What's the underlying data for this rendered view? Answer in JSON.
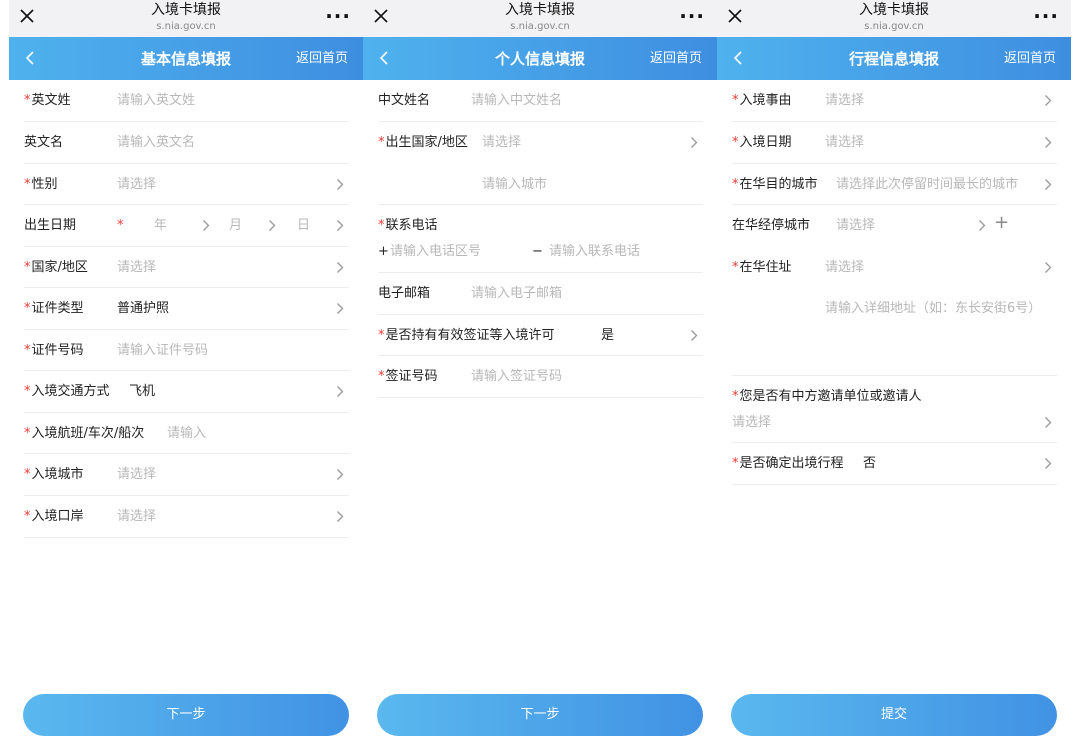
{
  "browser": {
    "title": "入境卡填报",
    "url": "s.nia.gov.cn",
    "more_icon": "···"
  },
  "required_mark": "*",
  "colors": {
    "header_start": "#4fb2ee",
    "header_end": "#3e8ee0",
    "required": "#e53935",
    "placeholder": "#b8b8b8"
  },
  "panels": [
    {
      "header": {
        "title": "基本信息填报",
        "home": "返回首页"
      },
      "fields": {
        "surname": {
          "label": "英文姓",
          "placeholder": "请输入英文姓"
        },
        "given_name": {
          "label": "英文名",
          "placeholder": "请输入英文名"
        },
        "gender": {
          "label": "性别",
          "placeholder": "请选择"
        },
        "birth_date": {
          "label": "出生日期",
          "year": "年",
          "month": "月",
          "day": "日"
        },
        "country": {
          "label": "国家/地区",
          "placeholder": "请选择"
        },
        "doc_type": {
          "label": "证件类型",
          "value": "普通护照"
        },
        "doc_number": {
          "label": "证件号码",
          "placeholder": "请输入证件号码"
        },
        "transport": {
          "label": "入境交通方式",
          "value": "飞机"
        },
        "flight": {
          "label": "入境航班/车次/船次",
          "placeholder": "请输入"
        },
        "city": {
          "label": "入境城市",
          "placeholder": "请选择"
        },
        "port": {
          "label": "入境口岸",
          "placeholder": "请选择"
        }
      },
      "button": "下一步"
    },
    {
      "header": {
        "title": "个人信息填报",
        "home": "返回首页"
      },
      "fields": {
        "chinese_name": {
          "label": "中文姓名",
          "placeholder": "请输入中文姓名"
        },
        "birth_country": {
          "label": "出生国家/地区",
          "placeholder": "请选择"
        },
        "birth_city": {
          "placeholder": "请输入城市"
        },
        "phone": {
          "label": "联系电话",
          "plus": "+",
          "code_placeholder": "请输入电话区号",
          "dash": "−",
          "number_placeholder": "请输入联系电话"
        },
        "email": {
          "label": "电子邮箱",
          "placeholder": "请输入电子邮箱"
        },
        "visa_hold": {
          "label": "是否持有有效签证等入境许可",
          "value": "是"
        },
        "visa_number": {
          "label": "签证号码",
          "placeholder": "请输入签证号码"
        }
      },
      "button": "下一步"
    },
    {
      "header": {
        "title": "行程信息填报",
        "home": "返回首页"
      },
      "fields": {
        "purpose": {
          "label": "入境事由",
          "placeholder": "请选择"
        },
        "entry_date": {
          "label": "入境日期",
          "placeholder": "请选择"
        },
        "destination": {
          "label": "在华目的城市",
          "placeholder": "请选择此次停留时间最长的城市"
        },
        "stopover": {
          "label": "在华经停城市",
          "placeholder": "请选择",
          "add": "+"
        },
        "address": {
          "label": "在华住址",
          "placeholder": "请选择",
          "detail_placeholder": "请输入详细地址（如：东长安街6号）"
        },
        "inviter": {
          "label": "您是否有中方邀请单位或邀请人",
          "placeholder": "请选择"
        },
        "exit_plan": {
          "label": "是否确定出境行程",
          "value": "否"
        }
      },
      "button": "提交"
    }
  ]
}
